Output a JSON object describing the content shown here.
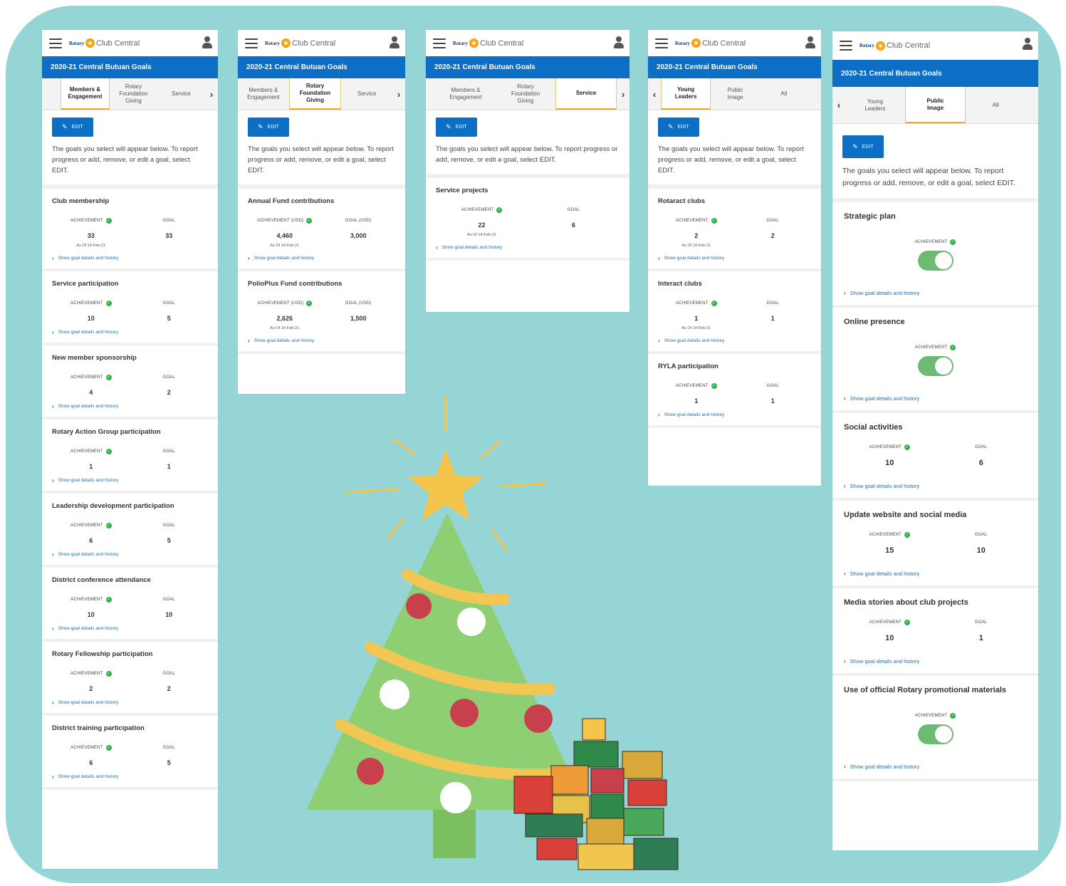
{
  "app": {
    "brand_rotary": "Rotary",
    "brand_club_central": "Club Central",
    "title": "2020-21 Central Butuan Goals",
    "edit_label": "EDIT",
    "edit_description": "The goals you select will appear below. To report progress or add, remove, or edit a goal, select EDIT.",
    "details_link": "Show goal details and history"
  },
  "panel1": {
    "tabs": [
      "Members &\nEngagement",
      "Rotary\nFoundation\nGiving",
      "Service"
    ],
    "goals": [
      {
        "title": "Club membership",
        "achievement_label": "ACHIEVEMENT",
        "goal_label": "GOAL",
        "achievement": "33",
        "goal": "33",
        "as_of": "As Of 14-Feb-21"
      },
      {
        "title": "Service participation",
        "achievement_label": "ACHIEVEMENT",
        "goal_label": "GOAL",
        "achievement": "10",
        "goal": "5"
      },
      {
        "title": "New member sponsorship",
        "achievement_label": "ACHIEVEMENT",
        "goal_label": "GOAL",
        "achievement": "4",
        "goal": "2"
      },
      {
        "title": "Rotary Action Group participation",
        "achievement_label": "ACHIEVEMENT",
        "goal_label": "GOAL",
        "achievement": "1",
        "goal": "1"
      },
      {
        "title": "Leadership development participation",
        "achievement_label": "ACHIEVEMENT",
        "goal_label": "GOAL",
        "achievement": "6",
        "goal": "5"
      },
      {
        "title": "District conference attendance",
        "achievement_label": "ACHIEVEMENT",
        "goal_label": "GOAL",
        "achievement": "10",
        "goal": "10"
      },
      {
        "title": "Rotary Fellowship participation",
        "achievement_label": "ACHIEVEMENT",
        "goal_label": "GOAL",
        "achievement": "2",
        "goal": "2"
      },
      {
        "title": "District training participation",
        "achievement_label": "ACHIEVEMENT",
        "goal_label": "GOAL",
        "achievement": "6",
        "goal": "5"
      }
    ]
  },
  "panel2": {
    "tabs": [
      "Members &\nEngagement",
      "Rotary\nFoundation\nGiving",
      "Service"
    ],
    "goals": [
      {
        "title": "Annual Fund contributions",
        "achievement_label": "ACHIEVEMENT (USD)",
        "goal_label": "GOAL (USD)",
        "achievement": "4,460",
        "goal": "3,000",
        "as_of": "As Of 14-Feb-21"
      },
      {
        "title": "PolioPlus Fund contributions",
        "achievement_label": "ACHIEVEMENT (USD)",
        "goal_label": "GOAL (USD)",
        "achievement": "2,626",
        "goal": "1,500",
        "as_of": "As Of 14-Feb-21"
      }
    ]
  },
  "panel3": {
    "tabs": [
      "Members &\nEngagement",
      "Rotary\nFoundation\nGiving",
      "Service"
    ],
    "goals": [
      {
        "title": "Service projects",
        "achievement_label": "ACHIEVEMENT",
        "goal_label": "GOAL",
        "achievement": "22",
        "goal": "6",
        "as_of": "As Of 14-Feb-21"
      }
    ]
  },
  "panel4": {
    "tabs": [
      "Young\nLeaders",
      "Public\nImage",
      "All"
    ],
    "goals": [
      {
        "title": "Rotaract clubs",
        "achievement_label": "ACHIEVEMENT",
        "goal_label": "GOAL",
        "achievement": "2",
        "goal": "2",
        "as_of": "As Of 14-Feb-21"
      },
      {
        "title": "Interact clubs",
        "achievement_label": "ACHIEVEMENT",
        "goal_label": "GOAL",
        "achievement": "1",
        "goal": "1",
        "as_of": "As Of 14-Feb-21"
      },
      {
        "title": "RYLA participation",
        "achievement_label": "ACHIEVEMENT",
        "goal_label": "GOAL",
        "achievement": "1",
        "goal": "1"
      }
    ]
  },
  "panel5": {
    "tabs": [
      "Young\nLeaders",
      "Public\nImage",
      "All"
    ],
    "goals": [
      {
        "title": "Strategic plan",
        "achievement_label": "ACHIEVEMENT",
        "toggle": true
      },
      {
        "title": "Online presence",
        "achievement_label": "ACHIEVEMENT",
        "toggle": true
      },
      {
        "title": "Social activities",
        "achievement_label": "ACHIEVEMENT",
        "goal_label": "GOAL",
        "achievement": "10",
        "goal": "6"
      },
      {
        "title": "Update website and social media",
        "achievement_label": "ACHIEVEMENT",
        "goal_label": "GOAL",
        "achievement": "15",
        "goal": "10"
      },
      {
        "title": "Media stories about club projects",
        "achievement_label": "ACHIEVEMENT",
        "goal_label": "GOAL",
        "achievement": "10",
        "goal": "1"
      },
      {
        "title": "Use of official Rotary promotional materials",
        "achievement_label": "ACHIEVEMENT",
        "toggle": true
      }
    ]
  },
  "colors": {
    "background": "#96d5d5",
    "header_blue": "#0c6ec4",
    "rotary_gold": "#f7a81b",
    "check_green": "#2fb44a",
    "toggle_green": "#6dbb73",
    "tree_green": "#8fcf73",
    "star_yellow": "#f4c54a",
    "ornament_red": "#c8404c"
  }
}
